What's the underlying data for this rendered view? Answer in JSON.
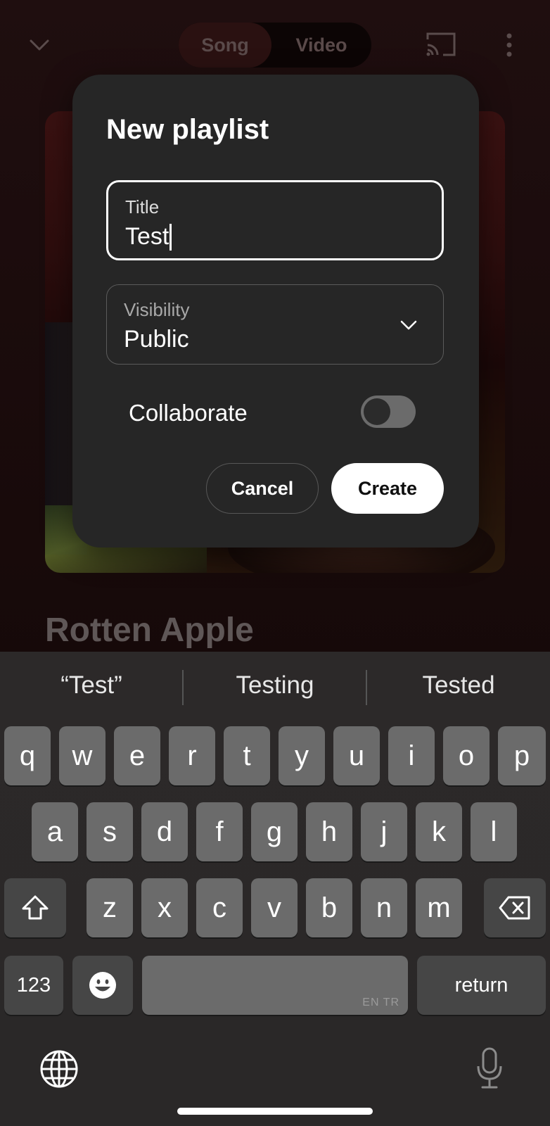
{
  "player": {
    "tabs": [
      {
        "label": "Song"
      },
      {
        "label": "Video"
      }
    ],
    "song_title": "Rotten Apple"
  },
  "dialog": {
    "title": "New playlist",
    "title_field": {
      "label": "Title",
      "value": "Test"
    },
    "visibility_field": {
      "label": "Visibility",
      "value": "Public"
    },
    "collaborate": {
      "label": "Collaborate",
      "on": false
    },
    "cancel_label": "Cancel",
    "create_label": "Create"
  },
  "keyboard": {
    "suggestions": [
      "“Test”",
      "Testing",
      "Tested"
    ],
    "row1": [
      "q",
      "w",
      "e",
      "r",
      "t",
      "y",
      "u",
      "i",
      "o",
      "p"
    ],
    "row2": [
      "a",
      "s",
      "d",
      "f",
      "g",
      "h",
      "j",
      "k",
      "l"
    ],
    "row3": [
      "z",
      "x",
      "c",
      "v",
      "b",
      "n",
      "m"
    ],
    "numbers_label": "123",
    "return_label": "return",
    "space_languages": "EN TR"
  },
  "icons": [
    "chevron-down-icon",
    "cast-icon",
    "more-vert-icon",
    "shift-icon",
    "backspace-icon",
    "emoji-icon",
    "globe-icon",
    "microphone-icon"
  ]
}
